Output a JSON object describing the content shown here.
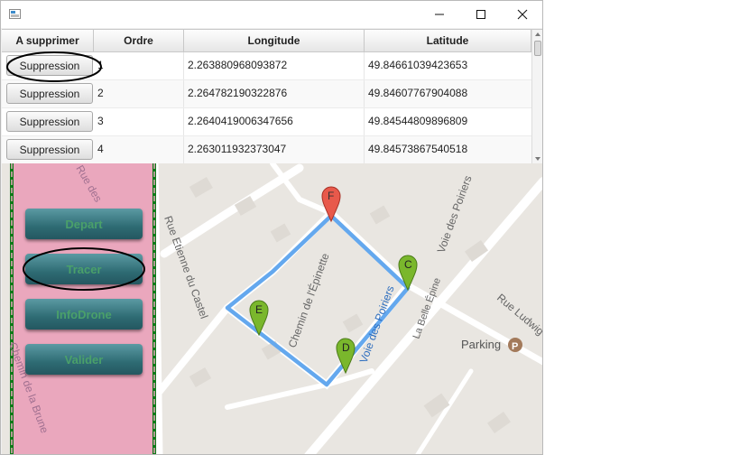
{
  "window": {
    "minimize_label": "—",
    "maximize_label": "☐",
    "close_label": "✕"
  },
  "table": {
    "columns": [
      "A supprimer",
      "Ordre",
      "Longitude",
      "Latitude"
    ],
    "rows": [
      {
        "action": "Suppression",
        "ordre": "1",
        "longitude": "2.263880968093872",
        "latitude": "49.84661039423653"
      },
      {
        "action": "Suppression",
        "ordre": "2",
        "longitude": "2.264782190322876",
        "latitude": "49.84607767904088"
      },
      {
        "action": "Suppression",
        "ordre": "3",
        "longitude": "2.2640419006347656",
        "latitude": "49.84544809896809"
      },
      {
        "action": "Suppression",
        "ordre": "4",
        "longitude": "2.263011932373047",
        "latitude": "49.84573867540518"
      }
    ]
  },
  "sidebar": {
    "buttons": [
      "Depart",
      "Tracer",
      "InfoDrone",
      "Valider"
    ]
  },
  "map": {
    "street_labels": [
      "Rue Etienne du Castel",
      "Chemin de l'Épinette",
      "Voie des Poiriers",
      "Voie des Poiriers",
      "La Belle Épine",
      "Rue Ludwig Straub",
      "Chemin de la Brune",
      "Rue des"
    ],
    "poi_label": "Parking",
    "poi_icon": "P",
    "markers": [
      "F",
      "C",
      "E",
      "D"
    ],
    "route_color": "#64a8ee",
    "marker_red": "#e8594b",
    "marker_green": "#7ab72c"
  }
}
